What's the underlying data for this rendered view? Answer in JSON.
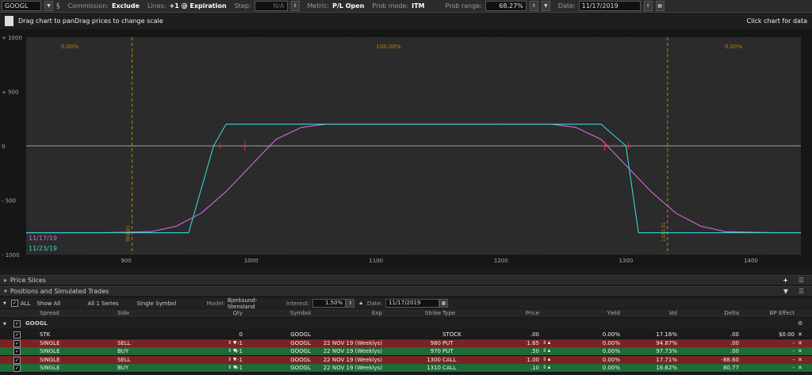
{
  "toolbar": {
    "symbol": "GOOGL",
    "commission_label": "Commission:",
    "commission_value": "Exclude",
    "lines_label": "Lines:",
    "lines_value": "+1 @ Expiration",
    "step_label": "Step:",
    "step_value": "N/A",
    "metric_label": "Metric:",
    "metric_value": "P/L Open",
    "prob_mode_label": "Prob mode:",
    "prob_mode_value": "ITM",
    "prob_range_label": "Prob range:",
    "prob_range_value": "68.27%",
    "date_label": "Date:",
    "date_value": "11/17/2019"
  },
  "hint": {
    "left": "Drag chart to panDrag prices to change scale",
    "right": "Click chart for data"
  },
  "chart": {
    "y_ticks": [
      "+ 1000",
      "+ 500",
      "0",
      "- 500",
      "- 1000"
    ],
    "x_ticks": [
      "900",
      "1000",
      "1100",
      "1200",
      "1300",
      "1400"
    ],
    "prob_labels": [
      "0.00%",
      "100.00%",
      "0.00%"
    ],
    "vline_labels": [
      "904.81",
      "1333.31"
    ],
    "legend": [
      {
        "label": "11/17/19",
        "color": "#d36ad9"
      },
      {
        "label": "11/23/19",
        "color": "#3ad3d3"
      }
    ],
    "colors": {
      "theo": "#d36ad9",
      "expiry": "#3ad3d3",
      "vline": "#b8860b",
      "zero": "#8a8a8a"
    }
  },
  "chart_data": {
    "type": "line",
    "xlim": [
      820,
      1440
    ],
    "ylim": [
      -1000,
      1000
    ],
    "series": [
      {
        "name": "11/17/19",
        "x": [
          820,
          880,
          920,
          940,
          960,
          980,
          1000,
          1020,
          1040,
          1060,
          1100,
          1150,
          1200,
          1240,
          1260,
          1280,
          1300,
          1320,
          1340,
          1360,
          1380,
          1420,
          1440
        ],
        "values": [
          -800,
          -800,
          -790,
          -740,
          -620,
          -420,
          -180,
          60,
          170,
          200,
          200,
          200,
          200,
          200,
          170,
          60,
          -180,
          -420,
          -620,
          -740,
          -790,
          -800,
          -800
        ]
      },
      {
        "name": "11/23/19",
        "x": [
          820,
          950,
          970,
          980,
          1280,
          1300,
          1310,
          1320,
          1440
        ],
        "values": [
          -800,
          -800,
          0,
          200,
          200,
          0,
          -800,
          -800,
          -800
        ]
      }
    ]
  },
  "sections": {
    "price_slices": "Price Slices",
    "positions": "Positions and Simulated Trades"
  },
  "filters": {
    "all_label": "ALL",
    "show": "Show All",
    "series": "All 1 Series",
    "symbol_mode": "Single Symbol",
    "model_label": "Model:",
    "model_value": "Bjerksund-Stensland",
    "interest_label": "Interest:",
    "interest_value": "1.50%",
    "date_label": "Date:",
    "date_value": "11/17/2019"
  },
  "table": {
    "headers": [
      "Spread",
      "Side",
      "Qty",
      "Symbol",
      "Exp",
      "Strike",
      "Type",
      "Price",
      "Yield",
      "Vol",
      "Delta",
      "BP Effect"
    ],
    "group": "GOOGL",
    "rows": [
      {
        "spread": "STK",
        "side": "",
        "qty": "0",
        "symbol": "GOOGL",
        "exp": "",
        "strike": "",
        "type": "STOCK",
        "price": ".00",
        "yield": "0.00%",
        "vol": "17.16%",
        "delta": ".00",
        "bp": "$0.00",
        "bg": "#1b1b1b"
      },
      {
        "spread": "SINGLE",
        "side": "SELL",
        "qty": "-1",
        "symbol": "GOOGL",
        "exp": "22 NOV 19 (Weeklys)",
        "strike": "980",
        "type": "PUT",
        "price": "1.65",
        "yield": "0.00%",
        "vol": "94.87%",
        "delta": ".00",
        "bp": "-",
        "bg": "#7a2323"
      },
      {
        "spread": "SINGLE",
        "side": "BUY",
        "qty": "+1",
        "symbol": "GOOGL",
        "exp": "22 NOV 19 (Weeklys)",
        "strike": "970",
        "type": "PUT",
        "price": ".50",
        "yield": "0.00%",
        "vol": "97.73%",
        "delta": ".00",
        "bp": "-",
        "bg": "#1e6b37"
      },
      {
        "spread": "SINGLE",
        "side": "SELL",
        "qty": "-1",
        "symbol": "GOOGL",
        "exp": "22 NOV 19 (Weeklys)",
        "strike": "1300",
        "type": "CALL",
        "price": "1.00",
        "yield": "0.00%",
        "vol": "17.71%",
        "delta": "-88.60",
        "bp": "-",
        "bg": "#7a2323"
      },
      {
        "spread": "SINGLE",
        "side": "BUY",
        "qty": "+1",
        "symbol": "GOOGL",
        "exp": "22 NOV 19 (Weeklys)",
        "strike": "1310",
        "type": "CALL",
        "price": ".10",
        "yield": "0.00%",
        "vol": "16.62%",
        "delta": "80.77",
        "bp": "-",
        "bg": "#1e6b37"
      }
    ]
  }
}
